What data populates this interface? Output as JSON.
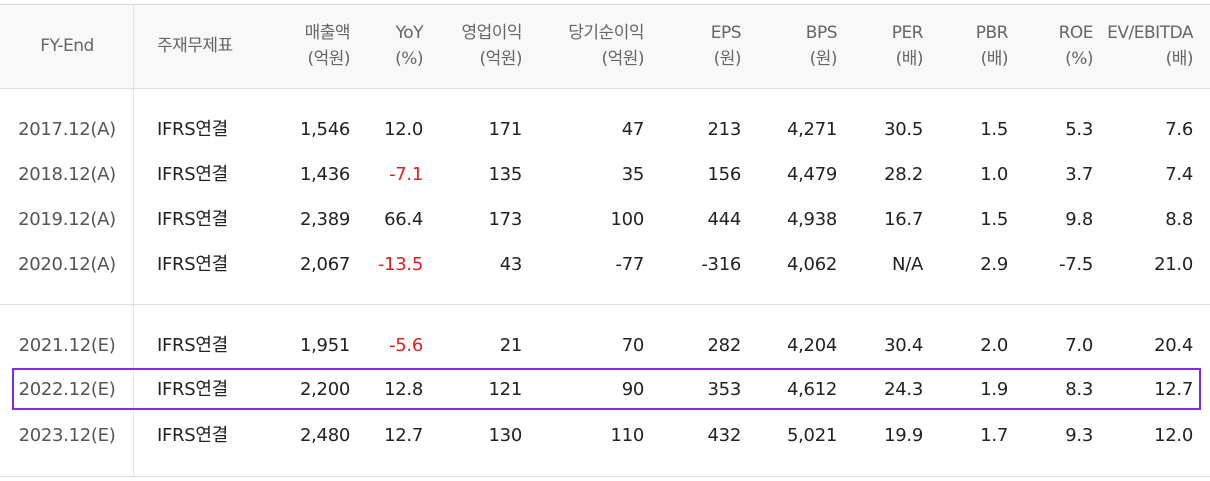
{
  "table": {
    "headers": [
      {
        "top": "FY-End",
        "bottom": ""
      },
      {
        "top": "주재무제표",
        "bottom": ""
      },
      {
        "top": "매출액",
        "bottom": "(억원)"
      },
      {
        "top": "YoY",
        "bottom": "(%)"
      },
      {
        "top": "영업이익",
        "bottom": "(억원)"
      },
      {
        "top": "당기순이익",
        "bottom": "(억원)"
      },
      {
        "top": "EPS",
        "bottom": "(원)"
      },
      {
        "top": "BPS",
        "bottom": "(원)"
      },
      {
        "top": "PER",
        "bottom": "(배)"
      },
      {
        "top": "PBR",
        "bottom": "(배)"
      },
      {
        "top": "ROE",
        "bottom": "(%)"
      },
      {
        "top": "EV/EBITDA",
        "bottom": "(배)"
      }
    ],
    "rows": [
      [
        "2017.12(A)",
        "IFRS연결",
        "1,546",
        "12.0",
        "171",
        "47",
        "213",
        "4,271",
        "30.5",
        "1.5",
        "5.3",
        "7.6"
      ],
      [
        "2018.12(A)",
        "IFRS연결",
        "1,436",
        "-7.1",
        "135",
        "35",
        "156",
        "4,479",
        "28.2",
        "1.0",
        "3.7",
        "7.4"
      ],
      [
        "2019.12(A)",
        "IFRS연결",
        "2,389",
        "66.4",
        "173",
        "100",
        "444",
        "4,938",
        "16.7",
        "1.5",
        "9.8",
        "8.8"
      ],
      [
        "2020.12(A)",
        "IFRS연결",
        "2,067",
        "-13.5",
        "43",
        "-77",
        "-316",
        "4,062",
        "N/A",
        "2.9",
        "-7.5",
        "21.0"
      ],
      [
        "2021.12(E)",
        "IFRS연결",
        "1,951",
        "-5.6",
        "21",
        "70",
        "282",
        "4,204",
        "30.4",
        "2.0",
        "7.0",
        "20.4"
      ],
      [
        "2022.12(E)",
        "IFRS연결",
        "2,200",
        "12.8",
        "121",
        "90",
        "353",
        "4,612",
        "24.3",
        "1.9",
        "8.3",
        "12.7"
      ],
      [
        "2023.12(E)",
        "IFRS연결",
        "2,480",
        "12.7",
        "130",
        "110",
        "432",
        "5,021",
        "19.9",
        "1.7",
        "9.3",
        "12.0"
      ]
    ],
    "highlighted_row": "2022.12(E)",
    "colors": {
      "negative_yoy": "#e02020",
      "highlight_border": "#7a2ee6"
    }
  }
}
